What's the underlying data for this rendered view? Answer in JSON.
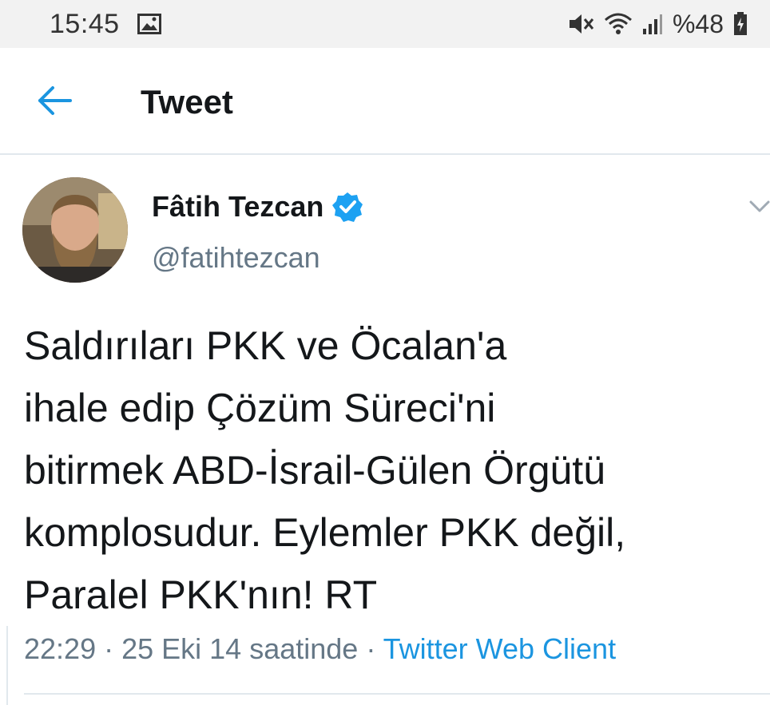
{
  "status_bar": {
    "time": "15:45",
    "battery": "%48",
    "icons": [
      "image-icon",
      "mute-icon",
      "wifi-icon",
      "signal-icon",
      "battery-icon"
    ]
  },
  "header": {
    "title": "Tweet",
    "back_icon": "arrow-left-icon"
  },
  "tweet": {
    "author_name": "Fâtih Tezcan",
    "handle": "@fatihtezcan",
    "verified": true,
    "text": "Saldırıları PKK ve Öcalan'a\nihale edip Çözüm Süreci'ni\nbitirmek ABD-İsrail-Gülen Örgütü\nkomplosudur. Eylemler PKK değil,\nParalel PKK'nın! RT",
    "time": "22:29",
    "separator": " · ",
    "date": "25 Eki 14 saatinde",
    "source": "Twitter Web Client"
  },
  "colors": {
    "accent": "#1b95e0",
    "secondary_text": "#657786",
    "divider": "#e1e8ed"
  }
}
